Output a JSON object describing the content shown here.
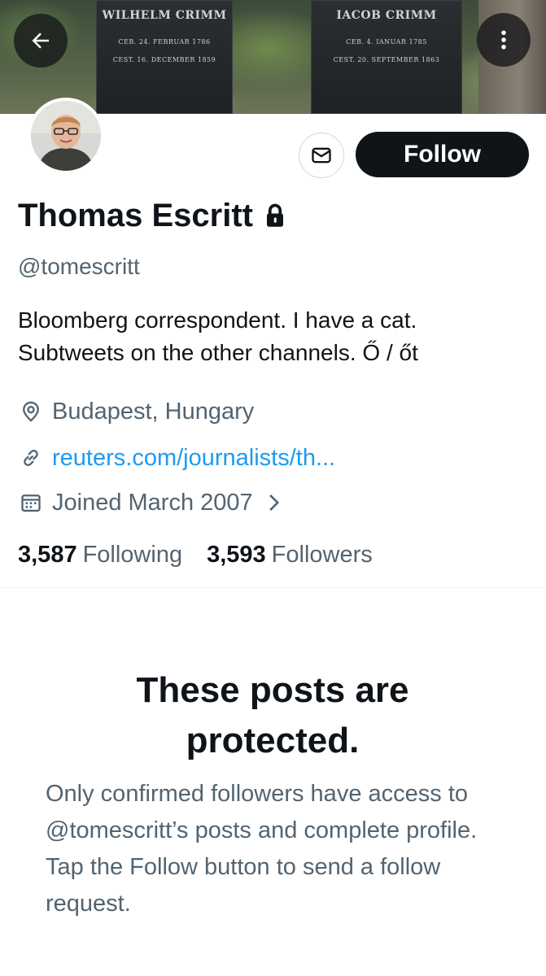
{
  "banner": {
    "stone_left": {
      "name": "WILHELM CRIMM",
      "line1": "CEB. 24. FEBRUAR 1786",
      "line2": "CEST. 16. DECEMBER 1859"
    },
    "stone_right": {
      "name": "IACOB CRIMM",
      "line1": "CEB. 4. IANUAR 1785",
      "line2": "CEST. 20. SEPTEMBER 1863"
    }
  },
  "header": {
    "back_icon": "arrow-left-icon",
    "more_icon": "vertical-ellipsis-icon"
  },
  "profile": {
    "display_name": "Thomas Escritt",
    "handle": "@tomescritt",
    "protected_icon": "lock-icon",
    "bio_line1": "Bloomberg correspondent. I have a cat.",
    "bio_line2": "Subtweets on the other channels. Ő / őt",
    "location": "Budapest, Hungary",
    "website": "reuters.com/journalists/th...",
    "joined": "Joined March 2007"
  },
  "actions": {
    "message_icon": "envelope-icon",
    "follow_label": "Follow"
  },
  "stats": {
    "following_count": "3,587",
    "following_label": "Following",
    "followers_count": "3,593",
    "followers_label": "Followers"
  },
  "protected": {
    "title_line1": "These posts are",
    "title_line2": "protected.",
    "body": "Only confirmed followers have access to @tomescritt’s posts and complete profile. Tap the Follow button to send a follow request."
  },
  "colors": {
    "text_primary": "#0f1419",
    "text_secondary": "#536471",
    "link": "#1d9bf0",
    "follow_button": "#0f1419"
  }
}
